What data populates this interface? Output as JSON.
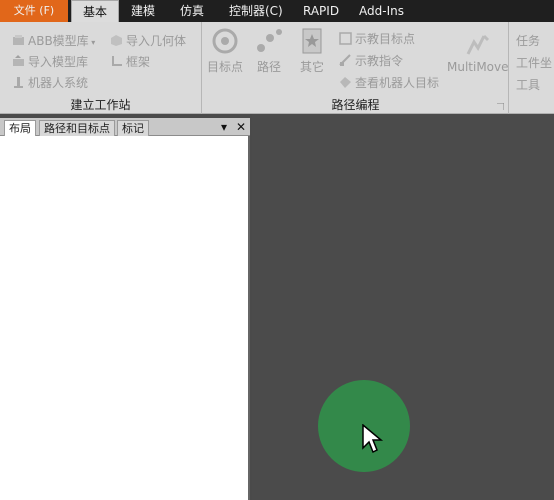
{
  "tabs": [
    {
      "label": "文件 (F)"
    },
    {
      "label": "基本"
    },
    {
      "label": "建模"
    },
    {
      "label": "仿真"
    },
    {
      "label": "控制器(C)"
    },
    {
      "label": "RAPID"
    },
    {
      "label": "Add-Ins"
    }
  ],
  "ribbon": {
    "station_group": {
      "label": "建立工作站",
      "abb_library": "ABB模型库",
      "import_library": "导入模型库",
      "robot_system": "机器人系统",
      "import_geometry": "导入几何体",
      "frame": "框架"
    },
    "path_group": {
      "label": "路径编程",
      "target": "目标点",
      "path": "路径",
      "other": "其它",
      "teach_target": "示教目标点",
      "teach_instruction": "示教指令",
      "view_robot_target": "查看机器人目标",
      "multimove": "MultiMove"
    },
    "partial_group": {
      "task": "任务",
      "workobject": "工件坐",
      "tool": "工具"
    }
  },
  "panel": {
    "tabs": [
      "布局",
      "路径和目标点",
      "标记"
    ],
    "dropdown_glyph": "▾",
    "close_glyph": "✕"
  },
  "colors": {
    "file_tab": "#e1671a",
    "click_indicator": "#33894a",
    "viewport": "#4b4b4b"
  },
  "icons": [
    "abb-library-icon",
    "import-library-icon",
    "robot-system-icon",
    "import-geometry-icon",
    "frame-icon",
    "target-icon",
    "path-icon",
    "other-icon",
    "teach-target-icon",
    "teach-instruction-icon",
    "view-target-icon",
    "multimove-icon",
    "cursor-icon"
  ]
}
